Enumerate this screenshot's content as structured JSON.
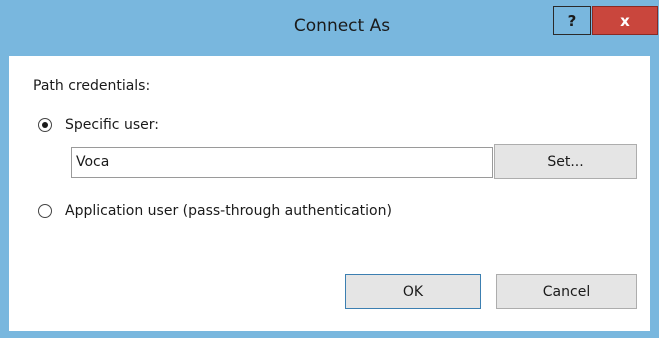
{
  "window": {
    "title": "Connect As",
    "help_label": "?",
    "close_label": "x"
  },
  "dialog": {
    "group_label": "Path credentials:",
    "specific_user_label": "Specific user:",
    "specific_user_selected": true,
    "username_value": "Voca",
    "set_button_label": "Set...",
    "app_user_label": "Application user (pass-through authentication)",
    "app_user_selected": false,
    "ok_label": "OK",
    "cancel_label": "Cancel"
  },
  "colors": {
    "titlebar": "#79b7de",
    "close_button": "#c9463d",
    "default_button_border": "#3c7fb1"
  }
}
